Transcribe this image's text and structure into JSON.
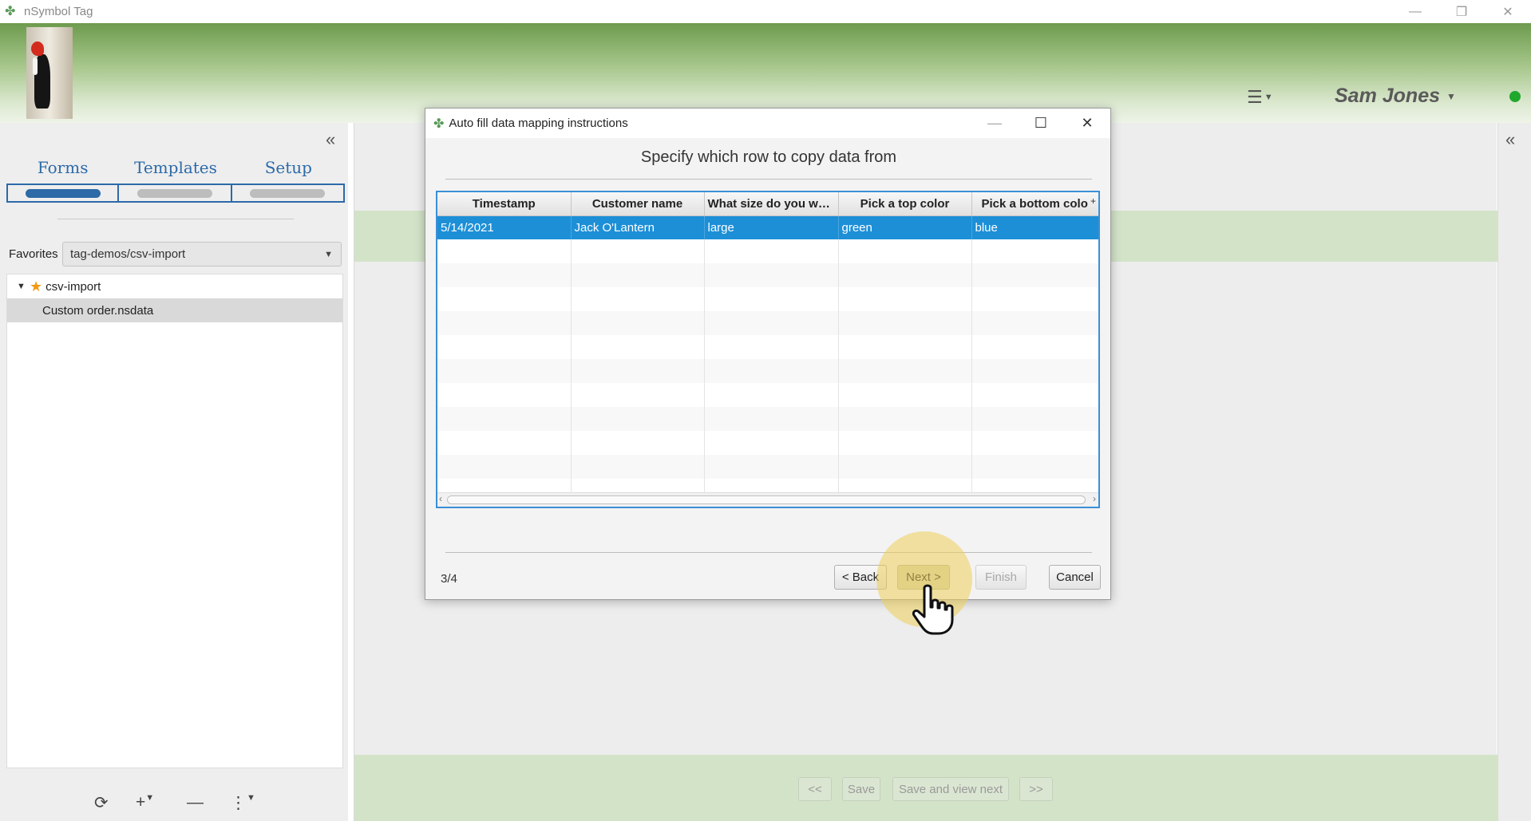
{
  "window": {
    "title": "nSymbol Tag"
  },
  "header": {
    "user_name": "Sam Jones",
    "status_color": "#1fa82b"
  },
  "sidebar": {
    "tabs": [
      {
        "label": "Forms",
        "active": true
      },
      {
        "label": "Templates",
        "active": false
      },
      {
        "label": "Setup",
        "active": false
      }
    ],
    "favorites_label": "Favorites",
    "favorites_value": "tag-demos/csv-import",
    "tree": {
      "folder": "csv-import",
      "file": "Custom order.nsdata"
    }
  },
  "dialog": {
    "title": "Auto fill data mapping instructions",
    "heading": "Specify which row to copy data from",
    "columns": [
      "Timestamp",
      "Customer name",
      "What size do you wa...",
      "Pick a top color",
      "Pick a bottom colo"
    ],
    "rows": [
      [
        "5/14/2021",
        "Jack O'Lantern",
        "large",
        "green",
        "blue"
      ]
    ],
    "step": "3/4",
    "buttons": {
      "back": "< Back",
      "next": "Next >",
      "finish": "Finish",
      "cancel": "Cancel"
    }
  },
  "footer_nav": {
    "first": "<<",
    "save": "Save",
    "save_next": "Save and view next",
    "last": ">>"
  },
  "colors": {
    "accent": "#2c6aa8",
    "selection": "#1d8fd7"
  }
}
